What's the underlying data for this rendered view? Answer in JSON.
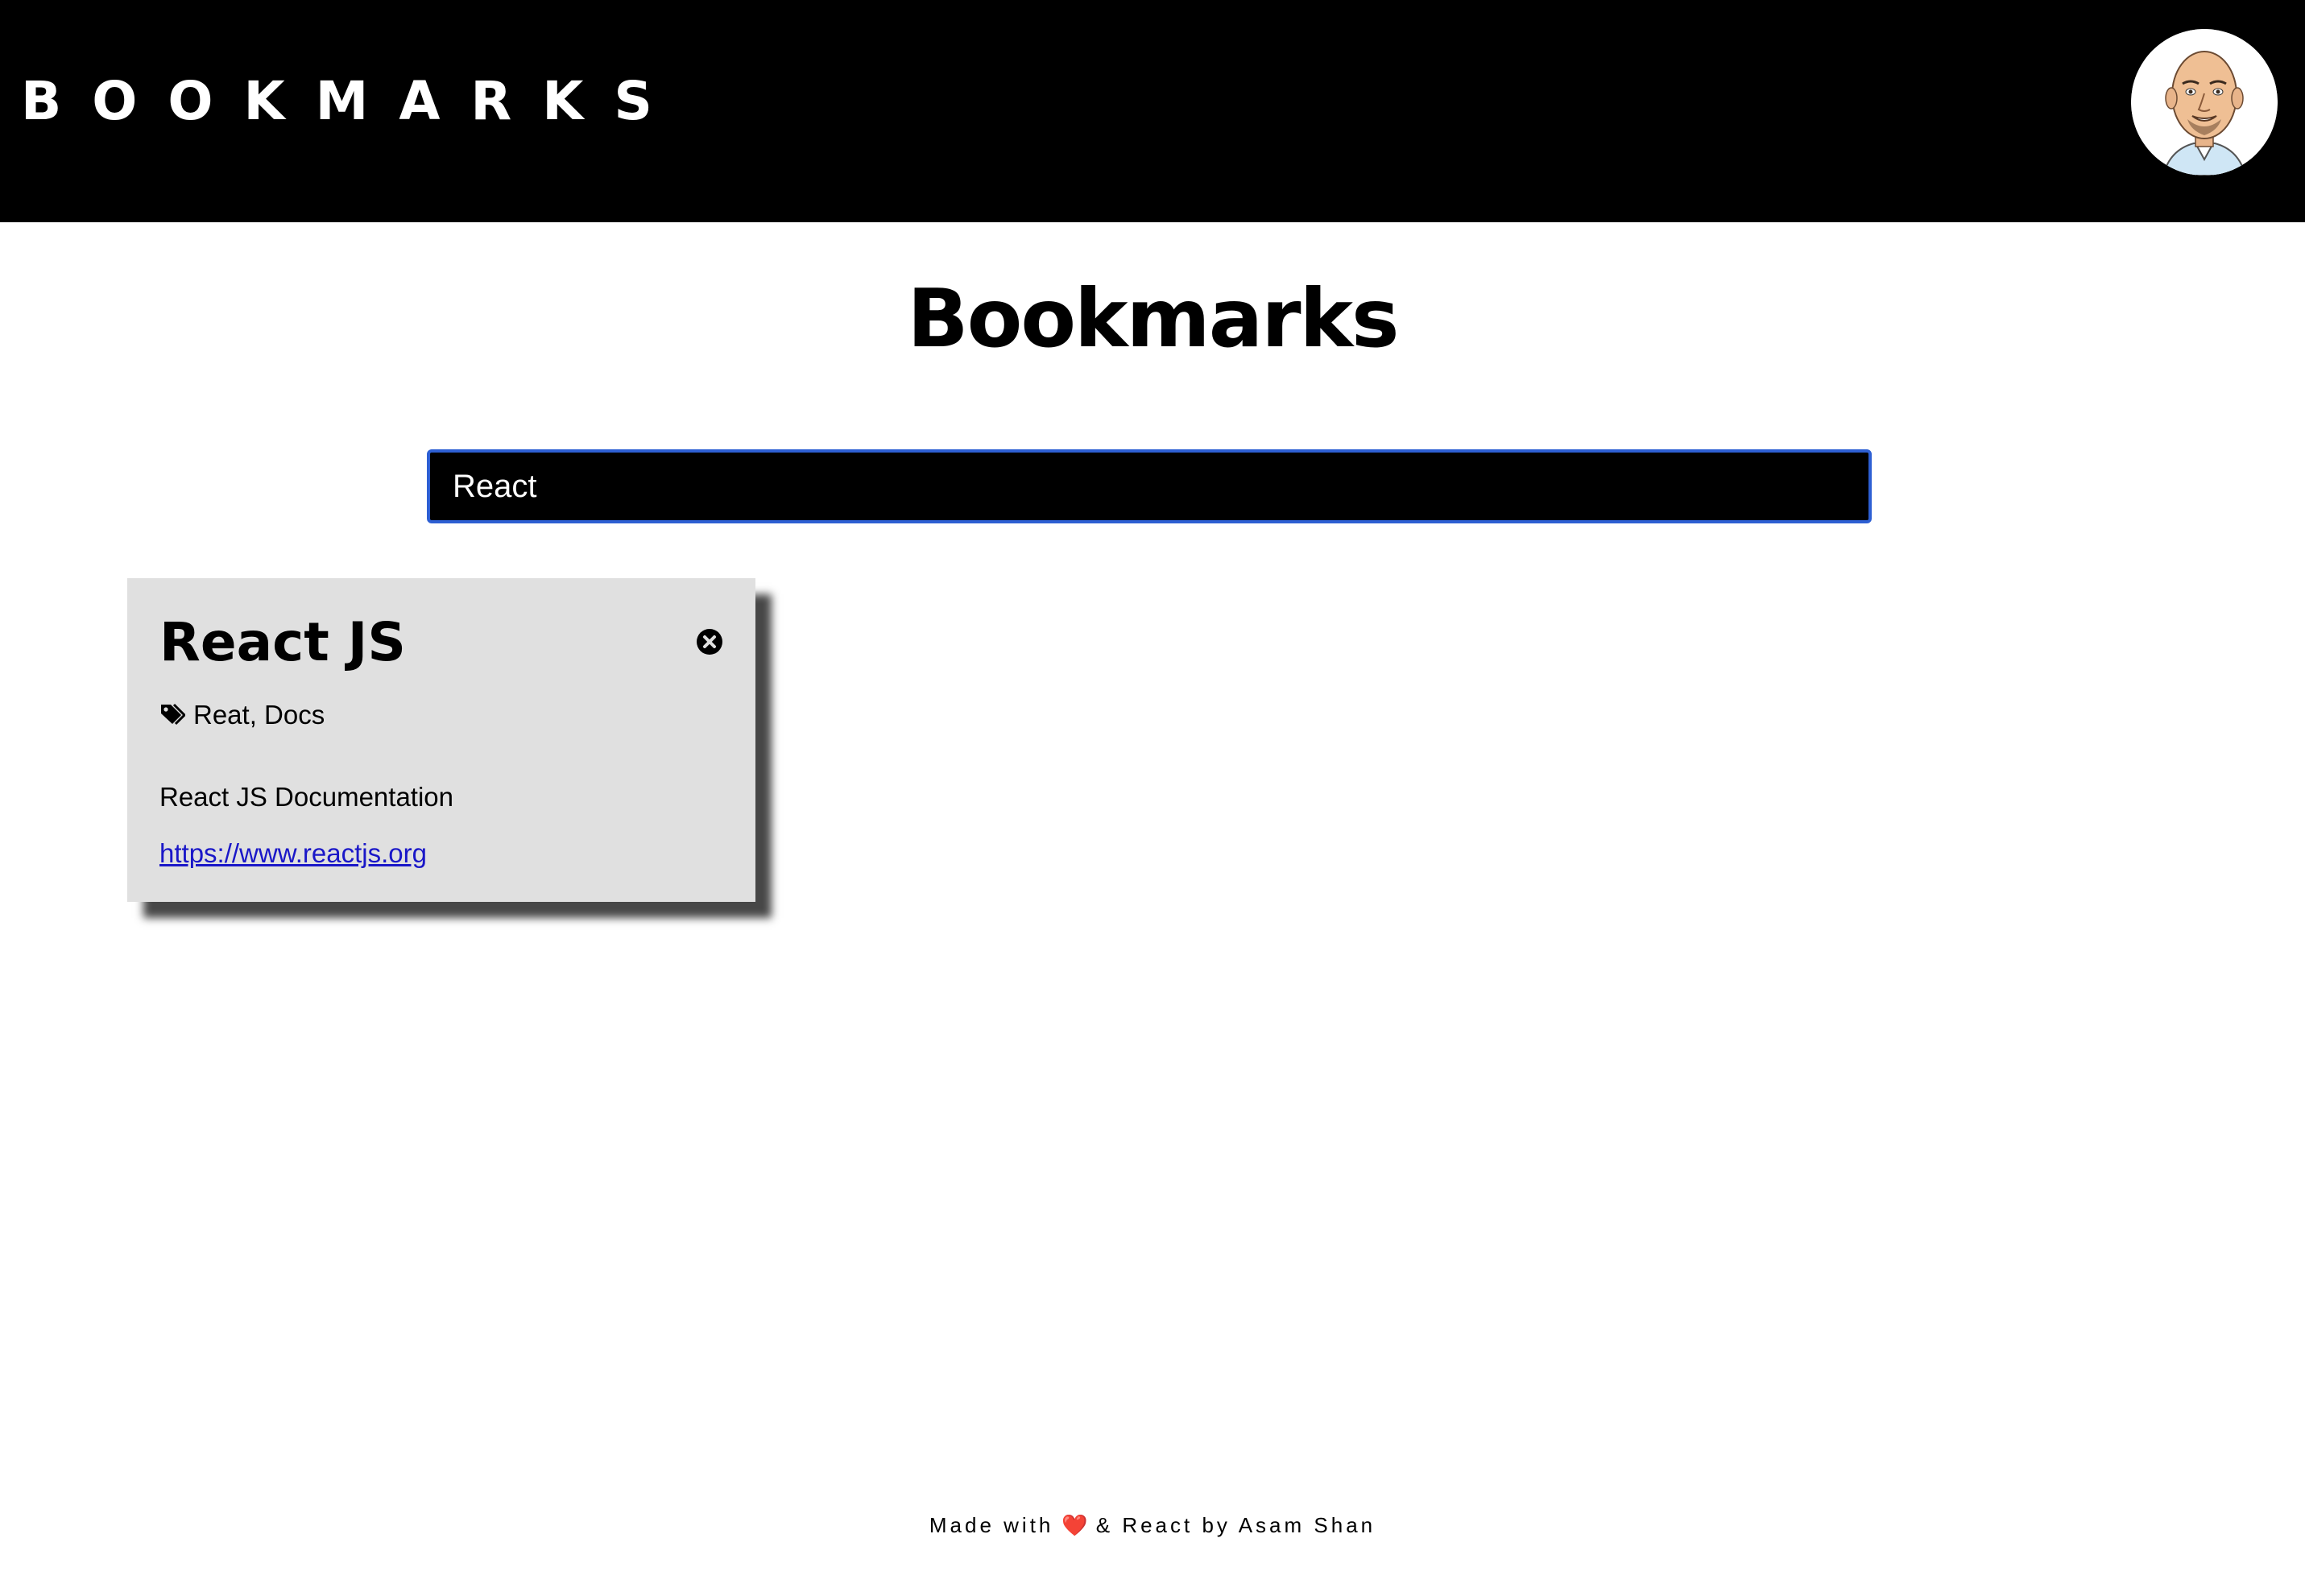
{
  "header": {
    "brand": "BOOKMARKS",
    "avatar_icon": "avatar-caricature"
  },
  "main": {
    "title": "Bookmarks",
    "search": {
      "value": "React",
      "placeholder": ""
    },
    "bookmarks": [
      {
        "title": "React JS",
        "tags_icon": "tags-icon",
        "tags": "Reat, Docs",
        "description": "React JS Documentation",
        "url": "https://www.reactjs.org",
        "close_icon": "close-circle-icon"
      }
    ]
  },
  "footer": {
    "made_with": "Made with",
    "heart": "❤️",
    "by": "& React by Asam Shan"
  },
  "colors": {
    "header_bg": "#000000",
    "card_bg": "#e0e0e0",
    "link": "#1a17c8",
    "search_border": "#2d5fd3"
  }
}
